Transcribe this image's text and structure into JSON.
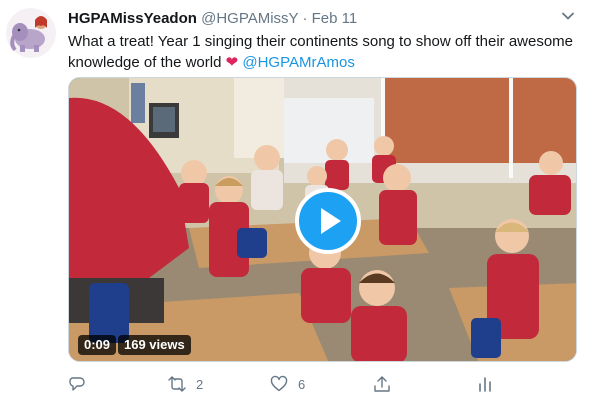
{
  "tweet": {
    "display_name": "HGPAMissYeadon",
    "handle": "@HGPAMissY",
    "separator": "·",
    "date": "Feb 11",
    "text_line1": "What a treat! Year 1 singing their continents song to show off their awesome",
    "text_line2": "knowledge of the world",
    "mention": "@HGPAMrAmos"
  },
  "video": {
    "duration": "0:09",
    "views": "169 views"
  },
  "actions": {
    "retweets": "2",
    "likes": "6"
  },
  "icons": {
    "avatar": "elephant-avatar-icon",
    "more": "chevron-down-icon",
    "reply": "reply-icon",
    "retweet": "retweet-icon",
    "like": "heart-icon",
    "share": "share-icon",
    "analytics": "analytics-icon",
    "play": "play-icon"
  },
  "colors": {
    "accent": "#1da1f2",
    "mention": "#1b95e0",
    "heart": "#e0245e",
    "muted": "#657786"
  }
}
